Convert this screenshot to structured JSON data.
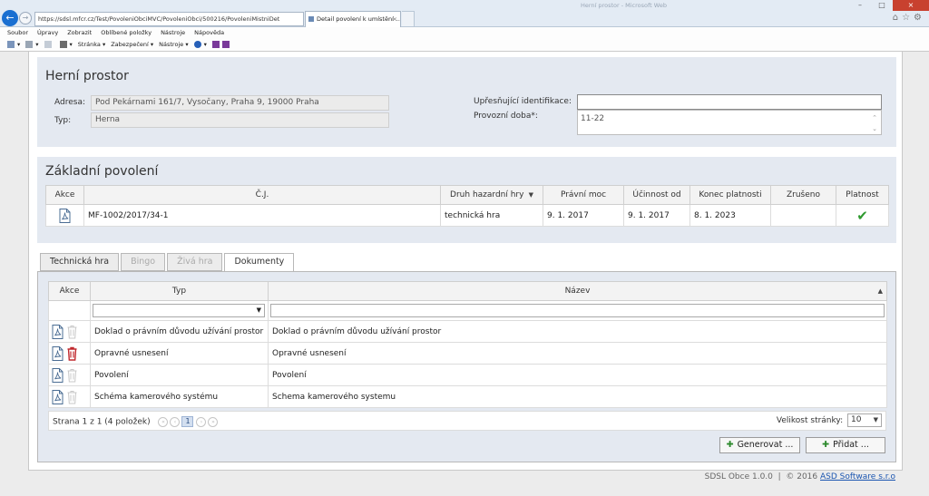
{
  "browser": {
    "address": "https://sdsl.mfcr.cz/Test/PovoleniObciMVC/PovoleniObci/500216/PovoleniMistniDet",
    "tab_title": "Detail povolení k umístění ...",
    "faded_title": "Herní prostor - Microsoft Web",
    "menu": [
      "Soubor",
      "Úpravy",
      "Zobrazit",
      "Oblíbené položky",
      "Nástroje",
      "Nápověda"
    ],
    "commands": [
      "Stránka ▾",
      "Zabezpečení ▾",
      "Nástroje ▾"
    ]
  },
  "herni_prostor": {
    "title": "Herní prostor",
    "adresa_label": "Adresa:",
    "adresa_value": "Pod Pekárnami 161/7, Vysočany, Praha 9, 19000 Praha",
    "typ_label": "Typ:",
    "typ_value": "Herna",
    "upresnujici_label": "Upřesňující identifikace:",
    "upresnujici_value": "",
    "provozni_label": "Provozní doba*:",
    "provozni_value": "11-22"
  },
  "zakladni_povoleni": {
    "title": "Základní povolení",
    "columns": [
      "Akce",
      "Č.J.",
      "Druh hazardní hry",
      "Právní moc",
      "Účinnost od",
      "Konec platnosti",
      "Zrušeno",
      "Platnost"
    ],
    "row": {
      "cj": "MF-1002/2017/34-1",
      "druh": "technická hra",
      "pravni_moc": "9. 1. 2017",
      "ucinnost_od": "9. 1. 2017",
      "konec_platnosti": "8. 1. 2023",
      "zruseno": ""
    }
  },
  "tabs": [
    "Technická hra",
    "Bingo",
    "Živá hra",
    "Dokumenty"
  ],
  "dokumenty": {
    "columns": [
      "Akce",
      "Typ",
      "Název"
    ],
    "rows": [
      {
        "typ": "Doklad o právním důvodu užívání prostor",
        "nazev": "Doklad o právním důvodu užívání prostor"
      },
      {
        "typ": "Opravné usnesení",
        "nazev": "Opravné usnesení"
      },
      {
        "typ": "Povolení",
        "nazev": "Povolení"
      },
      {
        "typ": "Schéma kamerového systému",
        "nazev": "Schema kamerového systemu"
      }
    ],
    "pager_text": "Strana 1 z 1 (4 položek)",
    "current_page": "1",
    "page_size_label": "Velikost stránky:",
    "page_size": "10"
  },
  "buttons": {
    "generovat": "Generovat ...",
    "pridat": "Přidat ..."
  },
  "footer": {
    "text": "SDSL Obce 1.0.0  |  © 2016 ",
    "link": "ASD Software s.r.o"
  },
  "colors": {
    "panel": "#e4e9f1",
    "check": "#2f9a2f",
    "delete": "#c0282d",
    "plus": "#2d8a2d"
  }
}
